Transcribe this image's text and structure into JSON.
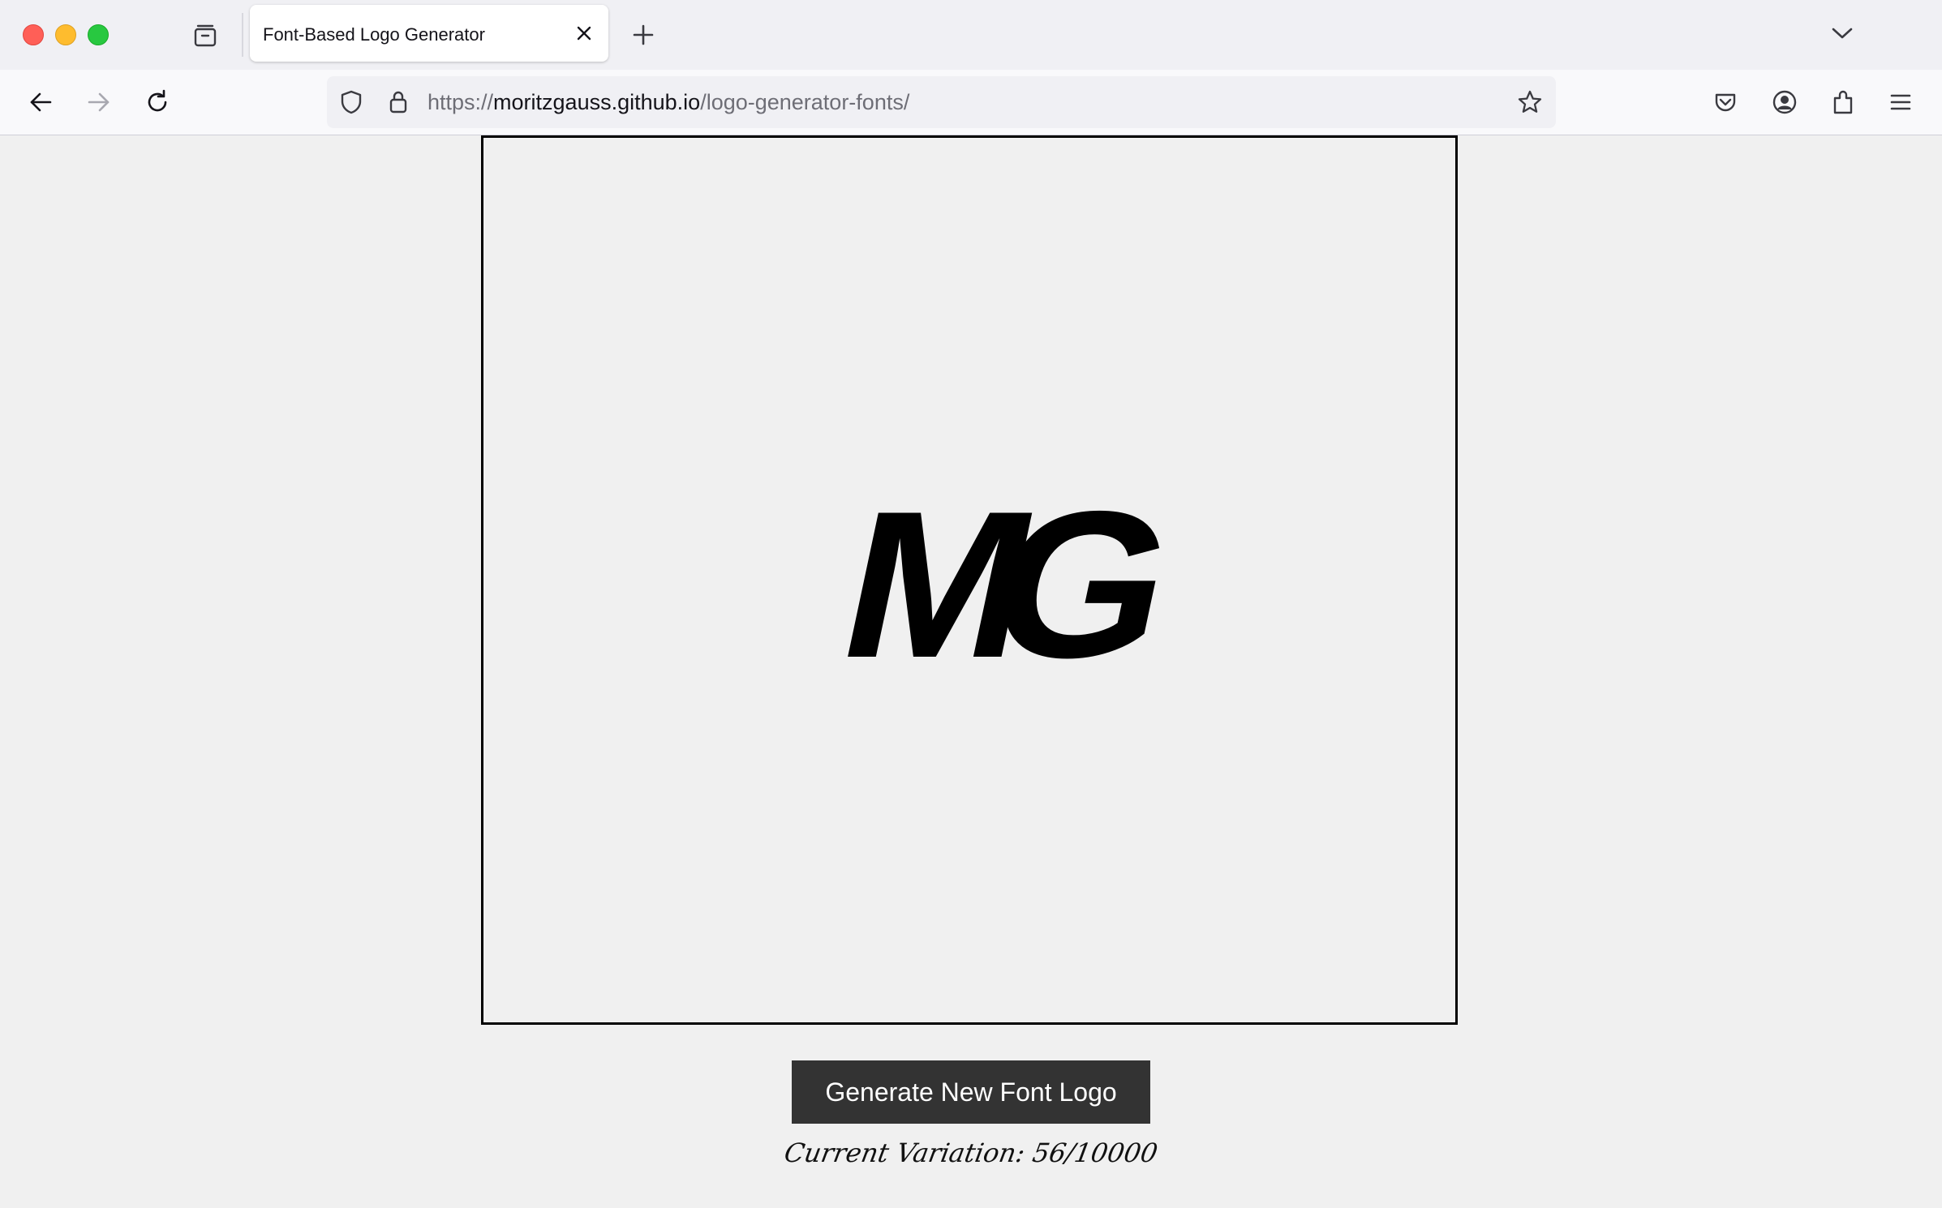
{
  "browser": {
    "tab": {
      "title": "Font-Based Logo Generator",
      "close_icon": "close-icon"
    },
    "tab_view_icon": "tab-view-icon",
    "new_tab_icon": "plus-icon",
    "tab_list_icon": "chevron-down-icon",
    "nav": {
      "back_icon": "arrow-left-icon",
      "forward_icon": "arrow-right-icon",
      "reload_icon": "reload-icon"
    },
    "url": {
      "scheme": "https://",
      "host": "moritzgauss.github.io",
      "path": "/logo-generator-fonts/",
      "shield_icon": "shield-icon",
      "lock_icon": "lock-icon",
      "bookmark_icon": "star-icon"
    },
    "toolbar_icons": [
      "pocket-icon",
      "account-icon",
      "extensions-icon",
      "menu-icon"
    ]
  },
  "page": {
    "logo": {
      "letters": "MG",
      "color": "#000000"
    },
    "generate_button_label": "Generate New Font Logo",
    "variation_text": "Current Variation: 56/10000"
  },
  "colors": {
    "traffic_close": "#ff5f57",
    "traffic_min": "#febc2e",
    "traffic_max": "#28c840",
    "button_bg": "#333333",
    "page_bg": "#f0f0f0"
  }
}
